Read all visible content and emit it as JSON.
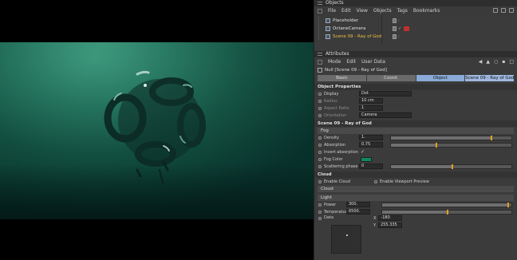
{
  "objects_manager": {
    "title": "Objects",
    "menu": [
      "File",
      "Edit",
      "View",
      "Objects",
      "Tags",
      "Bookmarks"
    ],
    "items": [
      {
        "name": "Placeholder",
        "highlighted": false
      },
      {
        "name": "OctaneCamera",
        "highlighted": false
      },
      {
        "name": "Scene 09 - Ray of God",
        "highlighted": true
      }
    ]
  },
  "attributes": {
    "title": "Attributes",
    "menu": [
      "Mode",
      "Edit",
      "User Data"
    ],
    "object_label": "Null [Scene 09 - Ray of God]",
    "tabs": [
      "Basic",
      "Coord.",
      "Object",
      "Scene 09 - Ray of God"
    ],
    "object_properties": {
      "heading": "Object Properties",
      "display_label": "Display",
      "display_value": "Dot",
      "radius_label": "Radius",
      "radius_value": "10 cm",
      "aspect_label": "Aspect Ratio",
      "aspect_value": "1",
      "orientation_label": "Orientation",
      "orientation_value": "Camera"
    },
    "scene_heading": "Scene 09 - Ray of God",
    "fog": {
      "heading": "Fog",
      "density_label": "Density",
      "density_value": "1.",
      "absorption_label": "Absorption",
      "absorption_value": "0.75",
      "invert_label": "Invert absorption",
      "invert_checked": "✓",
      "color_label": "Fog Color",
      "color": "#0e8a5e",
      "scatter_label": "Scattering phase",
      "scatter_value": "0"
    },
    "cloud": {
      "heading": "Cloud",
      "enable_label": "Enable Cloud",
      "viewport_label": "Enable Viewport Preview",
      "sub_heading": "Cloud"
    },
    "light": {
      "heading": "Light",
      "power_label": "Power",
      "power_value": "300.",
      "temp_label": "Temperature",
      "temp_value": "6500.",
      "data_label": "Data",
      "x_label": "X",
      "x_value": "-180",
      "y_label": "Y",
      "y_value": "255.335"
    }
  }
}
